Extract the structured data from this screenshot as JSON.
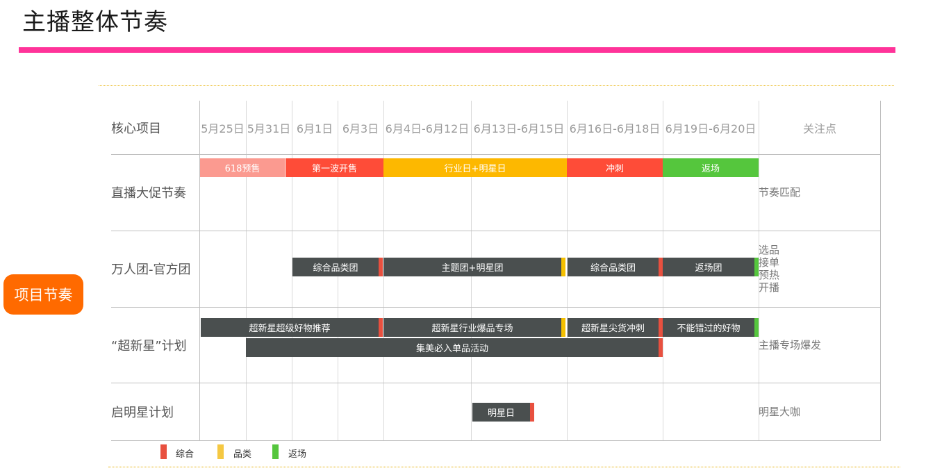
{
  "title": "主播整体节奏",
  "side_badge": "项目节奏",
  "header": {
    "first": "核心项目",
    "dates": [
      "5月25日",
      "5月31日",
      "6月1日",
      "6月3日",
      "6月4日-6月12日",
      "6月13日-6月15日",
      "6月16日-6月18日",
      "6月19日-6月20日"
    ],
    "focus": "关注点"
  },
  "rows": [
    {
      "label": "直播大促节奏",
      "focus": "节奏匹配"
    },
    {
      "label": "万人团-官方团",
      "focus": "选品\n接单\n预热\n开播"
    },
    {
      "label": "“超新星”计划",
      "focus": "主播专场爆发"
    },
    {
      "label": "启明星计划",
      "focus": "明星大咖"
    }
  ],
  "phases": [
    {
      "label": "618预售",
      "color": "#fb9a90"
    },
    {
      "label": "第一波开售",
      "color": "#fe4c38"
    },
    {
      "label": "行业日+明星日",
      "color": "#fdb800"
    },
    {
      "label": "冲刺",
      "color": "#fe4c38"
    },
    {
      "label": "返场",
      "color": "#55c63d"
    }
  ],
  "wanrentuan_bars": [
    "综合品类团",
    "主题团+明星团",
    "综合品类团",
    "返场团"
  ],
  "supernova_bars": [
    "超新星超级好物推荐",
    "超新星行业爆品专场",
    "超新星尖货冲刺",
    "不能错过的好物"
  ],
  "supernova_long_bar": "集美必入单品活动",
  "qimingxing_bar": "明星日",
  "legend": [
    {
      "label": "综合",
      "color": "#e8503f"
    },
    {
      "label": "品类",
      "color": "#f5c842"
    },
    {
      "label": "返场",
      "color": "#55c63d"
    }
  ],
  "colors": {
    "accent": "#ff3399",
    "badge": "#ff6a00",
    "dark_bar": "#4a4f4f",
    "red": "#e8503f",
    "yellow": "#f5c842",
    "green": "#55c63d"
  }
}
